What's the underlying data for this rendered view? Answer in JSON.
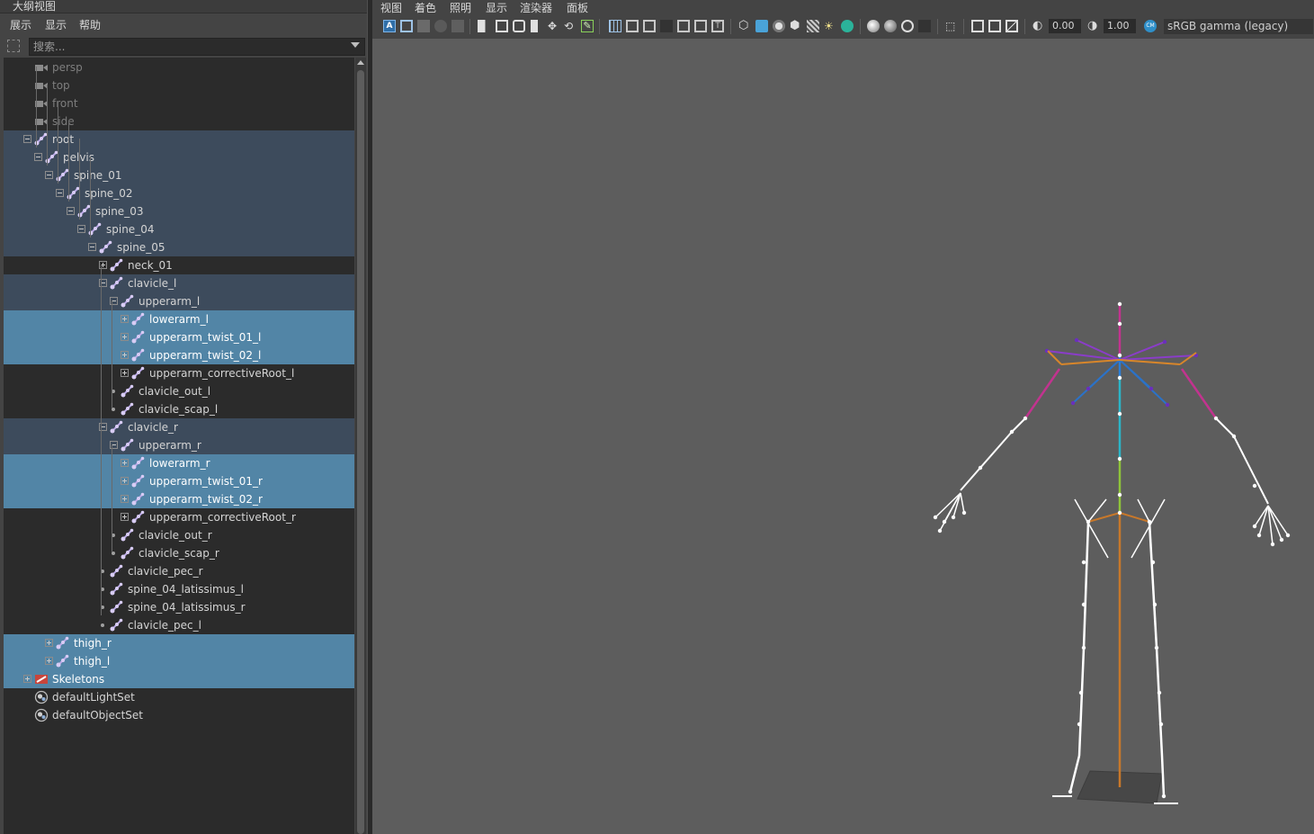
{
  "outliner": {
    "title": "大纲视图",
    "menu": [
      "展示",
      "显示",
      "帮助"
    ],
    "search_placeholder": "搜索...",
    "items": [
      {
        "label": "persp"
      },
      {
        "label": "top"
      },
      {
        "label": "front"
      },
      {
        "label": "side"
      },
      {
        "label": "root"
      },
      {
        "label": "pelvis"
      },
      {
        "label": "spine_01"
      },
      {
        "label": "spine_02"
      },
      {
        "label": "spine_03"
      },
      {
        "label": "spine_04"
      },
      {
        "label": "spine_05"
      },
      {
        "label": "neck_01"
      },
      {
        "label": "clavicle_l"
      },
      {
        "label": "upperarm_l"
      },
      {
        "label": "lowerarm_l"
      },
      {
        "label": "upperarm_twist_01_l"
      },
      {
        "label": "upperarm_twist_02_l"
      },
      {
        "label": "upperarm_correctiveRoot_l"
      },
      {
        "label": "clavicle_out_l"
      },
      {
        "label": "clavicle_scap_l"
      },
      {
        "label": "clavicle_r"
      },
      {
        "label": "upperarm_r"
      },
      {
        "label": "lowerarm_r"
      },
      {
        "label": "upperarm_twist_01_r"
      },
      {
        "label": "upperarm_twist_02_r"
      },
      {
        "label": "upperarm_correctiveRoot_r"
      },
      {
        "label": "clavicle_out_r"
      },
      {
        "label": "clavicle_scap_r"
      },
      {
        "label": "clavicle_pec_r"
      },
      {
        "label": "spine_04_latissimus_l"
      },
      {
        "label": "spine_04_latissimus_r"
      },
      {
        "label": "clavicle_pec_l"
      },
      {
        "label": "thigh_r"
      },
      {
        "label": "thigh_l"
      },
      {
        "label": "Skeletons"
      },
      {
        "label": "defaultLightSet"
      },
      {
        "label": "defaultObjectSet"
      }
    ]
  },
  "viewport": {
    "menu": [
      "视图",
      "着色",
      "照明",
      "显示",
      "渲染器",
      "面板"
    ],
    "exposure": "0.00",
    "gamma": "1.00",
    "color_space": "sRGB gamma (legacy)"
  },
  "colors": {
    "selection": "#5285a6",
    "selection_dim": "#3d4b5c",
    "joint_icon": "#b9a6e6",
    "viewport_bg": "#5d5d5d"
  }
}
